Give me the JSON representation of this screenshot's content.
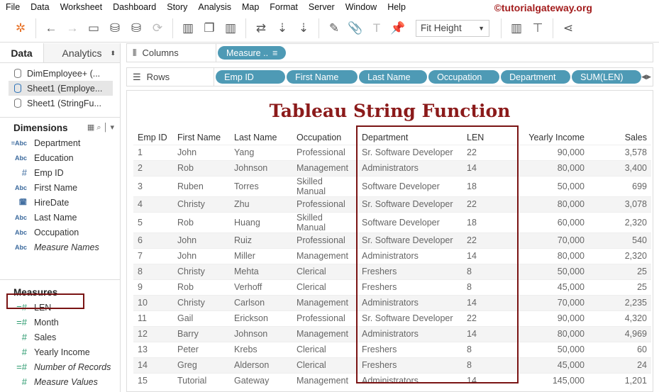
{
  "menu": [
    "File",
    "Data",
    "Worksheet",
    "Dashboard",
    "Story",
    "Analysis",
    "Map",
    "Format",
    "Server",
    "Window",
    "Help"
  ],
  "brand": "©tutorialgateway.org",
  "toolbar": {
    "fit": "Fit Height"
  },
  "left": {
    "tabs": [
      "Data",
      "Analytics"
    ],
    "sources": [
      "DimEmployee+ (...",
      "Sheet1 (Employe...",
      "Sheet1 (StringFu..."
    ],
    "dimensions_title": "Dimensions",
    "dimensions": [
      {
        "icon": "=Abc",
        "label": "Department"
      },
      {
        "icon": "Abc",
        "label": "Education"
      },
      {
        "icon": "#",
        "label": "Emp ID"
      },
      {
        "icon": "date",
        "label": "First Name"
      },
      {
        "icon": "date",
        "label": "HireDate"
      },
      {
        "icon": "Abc",
        "label": "Last Name"
      },
      {
        "icon": "Abc",
        "label": "Occupation"
      },
      {
        "icon": "Abc",
        "label": "Measure Names"
      }
    ],
    "measures_title": "Measures",
    "measures": [
      {
        "icon": "=#",
        "label": "LEN"
      },
      {
        "icon": "=#",
        "label": "Month"
      },
      {
        "icon": "#",
        "label": "Sales"
      },
      {
        "icon": "#",
        "label": "Yearly Income"
      },
      {
        "icon": "=#",
        "label": "Number of Records"
      },
      {
        "icon": "#",
        "label": "Measure Values"
      }
    ]
  },
  "shelves": {
    "columns_label": "Columns",
    "columns": [
      "Measure .."
    ],
    "rows_label": "Rows",
    "rows": [
      "Emp ID",
      "First Name",
      "Last Name",
      "Occupation",
      "Department",
      "SUM(LEN)"
    ]
  },
  "view": {
    "title": "Tableau String Function",
    "headers": [
      "Emp ID",
      "First Name",
      "Last Name",
      "Occupation",
      "Department",
      "LEN",
      "Yearly Income",
      "Sales"
    ],
    "rows": [
      [
        "1",
        "John",
        "Yang",
        "Professional",
        "Sr. Software Developer",
        "22",
        "90,000",
        "3,578"
      ],
      [
        "2",
        "Rob",
        "Johnson",
        "Management",
        "Administrators",
        "14",
        "80,000",
        "3,400"
      ],
      [
        "3",
        "Ruben",
        "Torres",
        "Skilled Manual",
        "Software Developer",
        "18",
        "50,000",
        "699"
      ],
      [
        "4",
        "Christy",
        "Zhu",
        "Professional",
        "Sr. Software Developer",
        "22",
        "80,000",
        "3,078"
      ],
      [
        "5",
        "Rob",
        "Huang",
        "Skilled Manual",
        "Software Developer",
        "18",
        "60,000",
        "2,320"
      ],
      [
        "6",
        "John",
        "Ruiz",
        "Professional",
        "Sr. Software Developer",
        "22",
        "70,000",
        "540"
      ],
      [
        "7",
        "John",
        "Miller",
        "Management",
        "Administrators",
        "14",
        "80,000",
        "2,320"
      ],
      [
        "8",
        "Christy",
        "Mehta",
        "Clerical",
        "Freshers",
        "8",
        "50,000",
        "25"
      ],
      [
        "9",
        "Rob",
        "Verhoff",
        "Clerical",
        "Freshers",
        "8",
        "45,000",
        "25"
      ],
      [
        "10",
        "Christy",
        "Carlson",
        "Management",
        "Administrators",
        "14",
        "70,000",
        "2,235"
      ],
      [
        "11",
        "Gail",
        "Erickson",
        "Professional",
        "Sr. Software Developer",
        "22",
        "90,000",
        "4,320"
      ],
      [
        "12",
        "Barry",
        "Johnson",
        "Management",
        "Administrators",
        "14",
        "80,000",
        "4,969"
      ],
      [
        "13",
        "Peter",
        "Krebs",
        "Clerical",
        "Freshers",
        "8",
        "50,000",
        "60"
      ],
      [
        "14",
        "Greg",
        "Alderson",
        "Clerical",
        "Freshers",
        "8",
        "45,000",
        "24"
      ],
      [
        "15",
        "Tutorial",
        "Gateway",
        "Management",
        "Administrators",
        "14",
        "145,000",
        "1,201"
      ]
    ]
  }
}
